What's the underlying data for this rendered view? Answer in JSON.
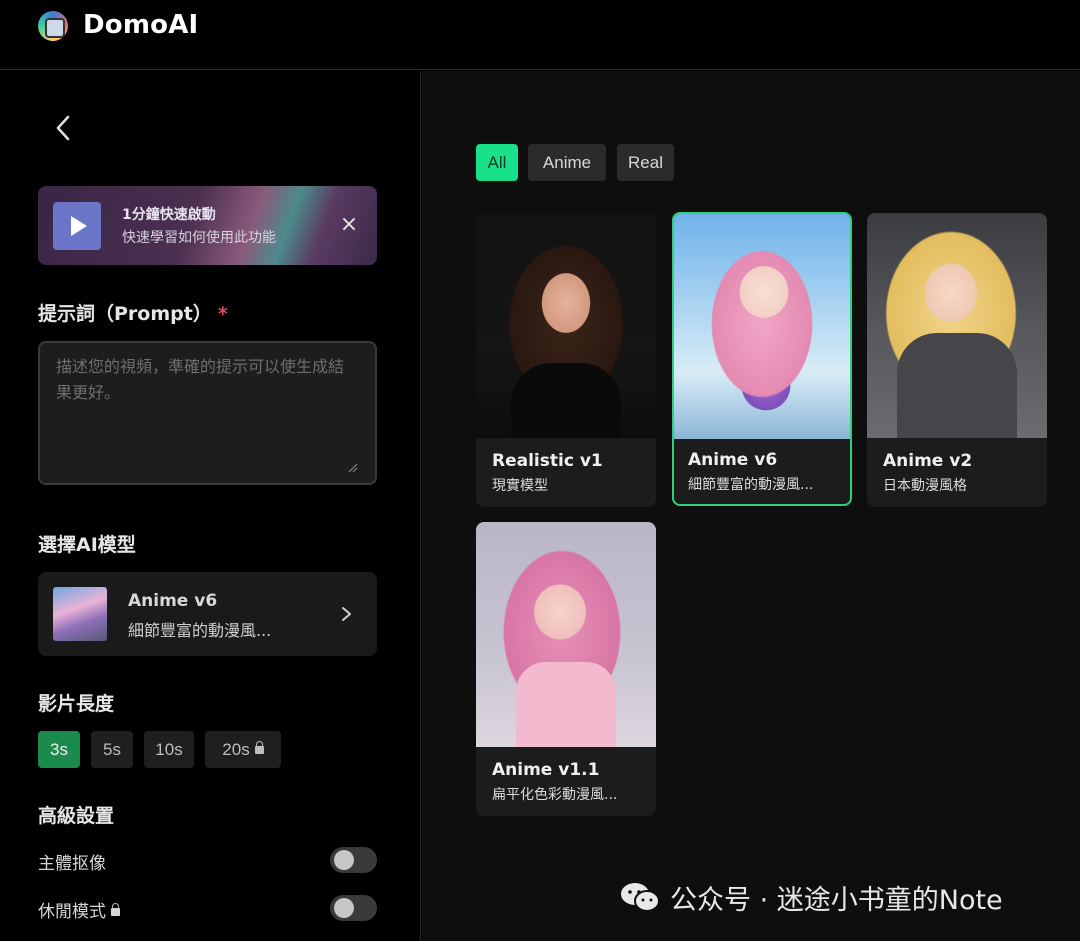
{
  "header": {
    "brand": "DomoAI"
  },
  "banner": {
    "title": "1分鐘快速啟動",
    "subtitle": "快速學習如何使用此功能",
    "close_symbol": "×"
  },
  "prompt": {
    "label": "提示詞（Prompt）",
    "required_mark": "*",
    "placeholder": "描述您的視頻，準確的提示可以使生成結果更好。",
    "value": ""
  },
  "model": {
    "label": "選擇AI模型",
    "selected_name": "Anime v6",
    "selected_desc": "細節豐富的動漫風..."
  },
  "duration": {
    "label": "影片長度",
    "options": [
      "3s",
      "5s",
      "10s",
      "20s"
    ],
    "selected": "3s"
  },
  "advanced": {
    "label": "高級設置",
    "toggles": [
      {
        "label": "主體抠像",
        "on": false,
        "locked": false
      },
      {
        "label": "休閒模式",
        "on": false,
        "locked": true
      }
    ]
  },
  "filters": {
    "options": [
      "All",
      "Anime",
      "Real"
    ],
    "selected": "All"
  },
  "models": [
    {
      "name": "Realistic v1",
      "desc": "現實模型",
      "selected": false
    },
    {
      "name": "Anime v6",
      "desc": "細節豐富的動漫風...",
      "selected": true
    },
    {
      "name": "Anime v2",
      "desc": "日本動漫風格",
      "selected": false
    },
    {
      "name": "Anime v1.1",
      "desc": "扁平化色彩動漫風...",
      "selected": false
    }
  ],
  "watermark": {
    "text": "公众号 · 迷途小书童的Note"
  },
  "colors": {
    "accent": "#19e08a",
    "selected_border": "#2bd17d",
    "duration_active": "#1a8b4a",
    "required": "#e44a5a"
  }
}
